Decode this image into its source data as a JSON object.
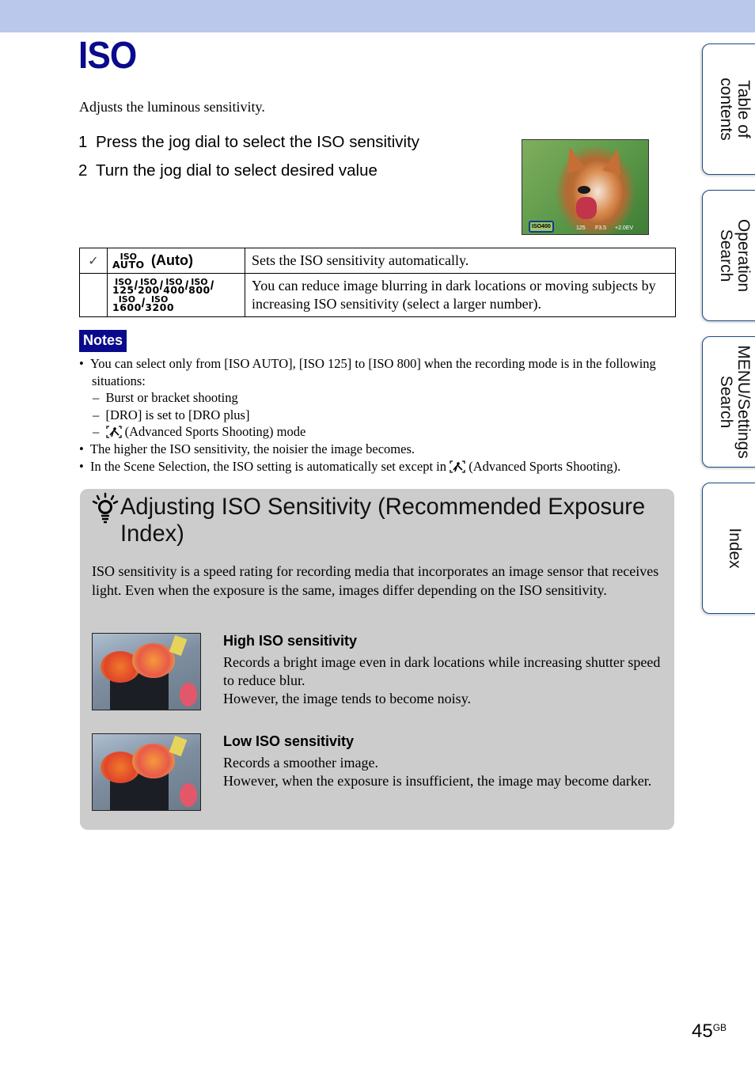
{
  "header": {
    "title": "ISO",
    "intro": "Adjusts the luminous sensitivity."
  },
  "steps": [
    {
      "num": "1",
      "text": "Press the jog dial to select the ISO sensitivity"
    },
    {
      "num": "2",
      "text": "Turn the jog dial to select desired value"
    }
  ],
  "preview": {
    "osd_iso": "ISO400",
    "osd_shutter": "125",
    "osd_aperture": "F3.5",
    "osd_ev": "+2.0EV"
  },
  "options": [
    {
      "default_mark": "✓",
      "icons": [
        {
          "top": "ISO",
          "bottom": "AUTO"
        }
      ],
      "label": "(Auto)",
      "description": "Sets the ISO sensitivity automatically."
    },
    {
      "default_mark": "",
      "icons": [
        {
          "top": "ISO",
          "bottom": "125"
        },
        {
          "top": "ISO",
          "bottom": "200"
        },
        {
          "top": "ISO",
          "bottom": "400"
        },
        {
          "top": "ISO",
          "bottom": "800"
        },
        {
          "top": "ISO",
          "bottom": "1600"
        },
        {
          "top": "ISO",
          "bottom": "3200"
        }
      ],
      "label": "",
      "description": "You can reduce image blurring in dark locations or moving subjects by increasing ISO sensitivity (select a larger number)."
    }
  ],
  "notes": {
    "badge": "Notes",
    "items": [
      {
        "type": "bullet",
        "text": "You can select only from [ISO AUTO], [ISO 125] to [ISO 800] when the recording mode is in the following situations:"
      },
      {
        "type": "dash",
        "text": "Burst or bracket shooting"
      },
      {
        "type": "dash",
        "text": "[DRO] is set to [DRO plus]"
      },
      {
        "type": "dash-icon",
        "text": "(Advanced Sports Shooting) mode"
      },
      {
        "type": "bullet",
        "text": "The higher the ISO sensitivity, the noisier the image becomes."
      },
      {
        "type": "bullet-icon",
        "text_before": "In the Scene Selection, the ISO setting is automatically set except in",
        "text_after": "(Advanced Sports Shooting)."
      }
    ]
  },
  "hint": {
    "title": "Adjusting ISO Sensitivity (Recommended Exposure Index)",
    "body": "ISO sensitivity is a speed rating for recording media that incorporates an image sensor that receives light. Even when the exposure is the same, images differ depending on the ISO sensitivity.",
    "examples": [
      {
        "heading": "High ISO sensitivity",
        "lines": [
          "Records a bright image even in dark locations while increasing shutter speed to reduce blur.",
          "However, the image tends to become noisy."
        ]
      },
      {
        "heading": "Low ISO sensitivity",
        "lines": [
          "Records a smoother image.",
          "However, when the exposure is insufficient, the image may become darker."
        ]
      }
    ]
  },
  "side_tabs": [
    {
      "label_line1": "Table of",
      "label_line2": "contents"
    },
    {
      "label_line1": "Operation",
      "label_line2": "Search"
    },
    {
      "label_line1": "MENU/Settings",
      "label_line2": "Search"
    },
    {
      "label_line1": "Index",
      "label_line2": ""
    }
  ],
  "page": {
    "number": "45",
    "suffix": "GB"
  },
  "colors": {
    "header_band": "#b9c8eb",
    "title": "#0a0a8c",
    "notes_badge": "#0a0a8c",
    "hint_bg": "#cccccc",
    "tab_border": "#1b4c8a"
  }
}
